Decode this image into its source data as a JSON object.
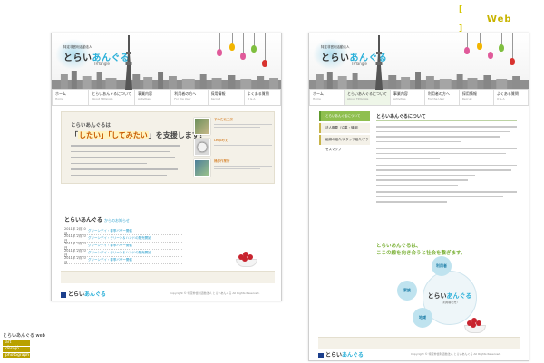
{
  "corner_tag": {
    "open": "[",
    "label": "Web",
    "close": "]"
  },
  "caption": "とらいあんぐる web",
  "credits": [
    "art direction",
    "design",
    "photograph"
  ],
  "site": {
    "org": "特定非営利活動法人",
    "name_plain": "とらい",
    "name_accent": "あんぐる",
    "name_en": "TRYangle"
  },
  "nav": [
    {
      "label": "ホーム",
      "sub": "Home"
    },
    {
      "label": "とらいあんぐるについて",
      "sub": "About TRYangle"
    },
    {
      "label": "事業内容",
      "sub": "Activities"
    },
    {
      "label": "利用者の方へ",
      "sub": "For the User"
    },
    {
      "label": "採用情報",
      "sub": "Recruit"
    },
    {
      "label": "よくある質問",
      "sub": "Q & A"
    }
  ],
  "page1": {
    "hero_title1": "とらいあんぐるは",
    "hero_title2_pre": "「",
    "hero_title2_hl": "したい」「してみたい",
    "hero_title2_post": "」を支援します!",
    "photo_titles": [
      "すみだ北工房",
      "Leapめぇ",
      "桶部作業所"
    ],
    "news_heading": "とらいあんぐる",
    "news_sub": "からのお知らせ",
    "news": [
      {
        "date": "2011年 2月10日",
        "text": "グリーンデイ・春季バザー開催"
      },
      {
        "date": "2011年 2月10日",
        "text": "グリーンデイ・クリーン＆ハンドの販売開始"
      },
      {
        "date": "2011年 2月10日",
        "text": "グリーンデイ・春季バザー開催"
      },
      {
        "date": "2011年 2月10日",
        "text": "グリーンデイ・クリーン＆ハンドの販売開始"
      },
      {
        "date": "2011年 2月10日",
        "text": "グリーンデイ・春季バザー開催"
      }
    ],
    "copyright": "Copyright © 特定非営利活動法人 とらいあんぐる All Rights Reserved."
  },
  "page2": {
    "side": [
      "とらいあんぐるについて",
      "法人概要（沿革・情報）",
      "組織の紹介/スタッフ紹介/アクセスマップ"
    ],
    "title": "とらいあんぐるについて",
    "green1": "とらいあんぐるは、",
    "green2": "ここの線を向き合うと社会を繋ぎます。",
    "circle_main_plain": "とらい",
    "circle_main_accent": "あんぐる",
    "circle_main_sub": "（利用者の方）",
    "circle_left": "家族",
    "circle_top": "利用者",
    "circle_bottom": "地域",
    "copyright": "Copyright © 特定非営利活動法人 とらいあんぐる All Rights Reserved."
  }
}
